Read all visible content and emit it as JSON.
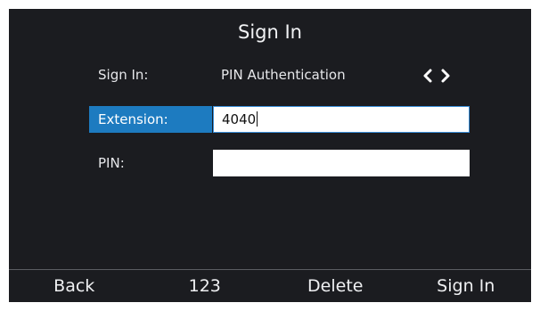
{
  "screen": {
    "title": "Sign In"
  },
  "form": {
    "sign_in": {
      "label": "Sign In:",
      "value": "PIN Authentication"
    },
    "extension": {
      "label": "Extension:",
      "value": "4040"
    },
    "pin": {
      "label": "PIN:",
      "value": ""
    }
  },
  "softkeys": {
    "back": "Back",
    "input_mode": "123",
    "delete": "Delete",
    "sign_in": "Sign In"
  },
  "colors": {
    "background": "#1b1c20",
    "selection": "#1d7bc0",
    "text": "#e6e7ea"
  },
  "icons": {
    "prev": "chevron-left-icon",
    "next": "chevron-right-icon"
  }
}
